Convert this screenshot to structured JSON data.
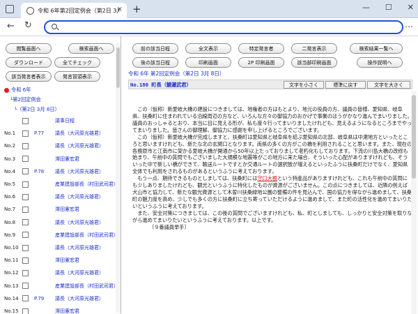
{
  "browser": {
    "tab_title": "令和 6年第2回定例会（第2日 3月 8日）",
    "tab_close": "×",
    "new_tab": "+",
    "address_value": "",
    "window_controls": [
      "—",
      "☐",
      "✕"
    ],
    "nav_back": "←",
    "nav_reload": "↻",
    "menu": "⋯"
  },
  "left_buttons": {
    "view_screen": "閲覧画面へ",
    "search_screen": "検索画面へ",
    "download": "ダウンロード",
    "check_all": "全てチェック",
    "show_speakers": "該当発言者表示",
    "show_attendees": "発言冒頭表示"
  },
  "tree": {
    "root": "令和 6年",
    "session": "第2回定例会",
    "day": "（第2日 3月 8日）"
  },
  "items": [
    {
      "no": "",
      "page": "",
      "name": "議事日程"
    },
    {
      "no": "No.1",
      "page": "P.77",
      "name": "議長（大河原光雄君）"
    },
    {
      "no": "No.2",
      "page": "",
      "name": "議長（大河原光雄君）"
    },
    {
      "no": "No.3",
      "page": "",
      "name": "澤田憲宏君"
    },
    {
      "no": "No.4",
      "page": "P.78",
      "name": "議長（大河原光雄君）"
    },
    {
      "no": "No.5",
      "page": "",
      "name": "産業建設部長（村田武司君）"
    },
    {
      "no": "No.6",
      "page": "",
      "name": "議長（大河原光雄君）"
    },
    {
      "no": "No.7",
      "page": "",
      "name": "澤田憲宏君"
    },
    {
      "no": "No.8",
      "page": "",
      "name": "議長（大河原光雄君）"
    },
    {
      "no": "No.9",
      "page": "",
      "name": "産業建設部長（村田武司君）"
    },
    {
      "no": "No.10",
      "page": "",
      "name": "議長（大河原光雄君）"
    },
    {
      "no": "No.11",
      "page": "",
      "name": "澤田憲宏君"
    },
    {
      "no": "No.12",
      "page": "",
      "name": "議長（大河原光雄君）"
    },
    {
      "no": "No.13",
      "page": "",
      "name": "産業建設部長（村田武司君）"
    },
    {
      "no": "No.14",
      "page": "P.79",
      "name": "議長（大河原光雄君）"
    },
    {
      "no": "No.15",
      "page": "",
      "name": "澤田憲宏君"
    }
  ],
  "right_buttons": {
    "prev_day": "前の該当日程",
    "show_all": "全文表示",
    "specific_speaker": "特定発言者",
    "two_speakers": "二発言表示",
    "search_list": "検索結果一覧へ",
    "next_day": "後の該当日程",
    "print_screen": "印刷画面",
    "print_2p": "2P 印刷画面",
    "print_part": "該当部印刷画面",
    "help": "操作説明へ"
  },
  "doc": {
    "header": "令和 6年 第2回定例会（第2日 3月 8日）",
    "speaker": "No.180 町長（鯖瀬武君）",
    "btn_smaller": "文字を小さく",
    "btn_default": "標準に戻す",
    "btn_larger": "文字を大きく",
    "p1": "　この（仮称）新愛岐大橋の建設につきましては、地権者の方はもとより、地元の役員の方、議員の皆様、愛知県、岐阜県、扶桑町に住まわれている沿線周辺の方など、いろんな方々の御協力のおかげで事業のほうがかなり進んでまいりました。議員のおっしゃるとおり、本当に目に見える形が、私も度々行ってまいりましたけれども、見えるようになるところまでやってまいりました。皆さんの御理解、御協力に感謝を申し上げるところでございます。",
    "p2a": "　この（仮称）新愛岐大橋が完成しますと、扶桑町は愛知県と岐阜県を結ぶ愛知県の北部、岐阜県は中濃地方といったところと思いますけれども、新たな北の玄関口となります。両県の多くの方がこの橋を利用されることと思います。また、現在の各務原市と江南市に架かる愛岐大橋が開通から50年以上たっておりまして老朽化もしております。下流の川島大橋の改修も始まり、午前中の質問でもございました大規模な地震等がこの地方に来た場合、そういった心配がありますけれども、そういった中で新しい橋ができて、輸送ルートですとか交通ルートの選択肢が増えるといったふうに扶桑町だけでなく、愛知県全体でも利用をされるものがあるというふうに考えております。",
    "p2b_pre": "　もう一点、期待できるものとしましては、扶桑町には",
    "p2b_hl": "守口大根",
    "p2b_post": "という特産品がありますけれども、これも午前中の質問にも少しありましたけれども、観光というふうに特化したものが資源がございません。この点につきましては、近隣の例えば犬山市と協力して、新たな観光資源として木曽川扶桑緑地公園の整備の件を見込んで、国の協力を得ながら進めまして、扶桑町の魅力度を高め、少しでも多くの方に扶桑町に立ち寄っていただけるように進めまして、また町の活性化を進めてまいりたいというふうに考えております。",
    "p3": "　また、安全対策につきましては、この後の質問でございますけれども、私、町としましても、しっかりと安全対策を取りながら進めてまいりたいというふうに考えております。以上です。",
    "p4": "〔９番議員挙手〕"
  }
}
